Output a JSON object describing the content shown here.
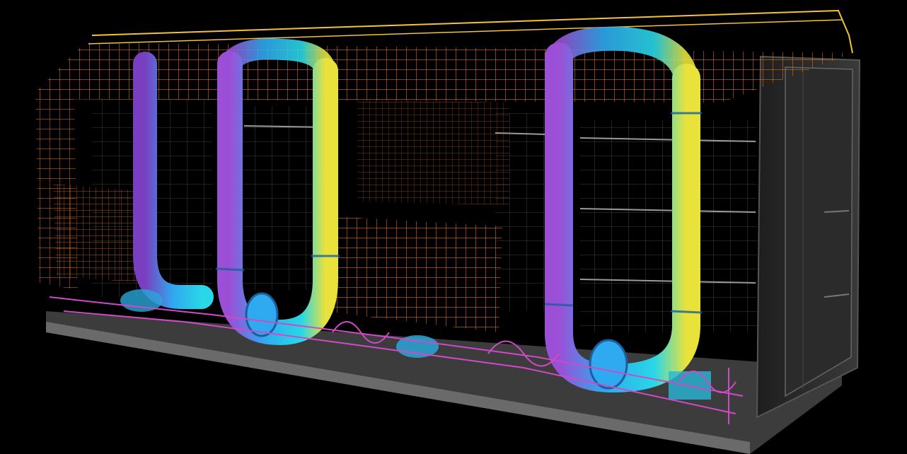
{
  "scene": {
    "subject": "wireframe-render",
    "colors": {
      "background": "#000000",
      "wire_orange": "#e0701f",
      "wire_yellow": "#f2c23a",
      "wire_magenta": "#d04ac8",
      "pipe_purple": "#9b4fd6",
      "pipe_blue": "#2fa9f0",
      "pipe_cyan": "#29d7e6",
      "pipe_yellow": "#e9e23a",
      "frame_grey": "#4a4a4a",
      "panel_dark": "#2a2a2a",
      "shelf_light": "#9a9a9a"
    }
  }
}
